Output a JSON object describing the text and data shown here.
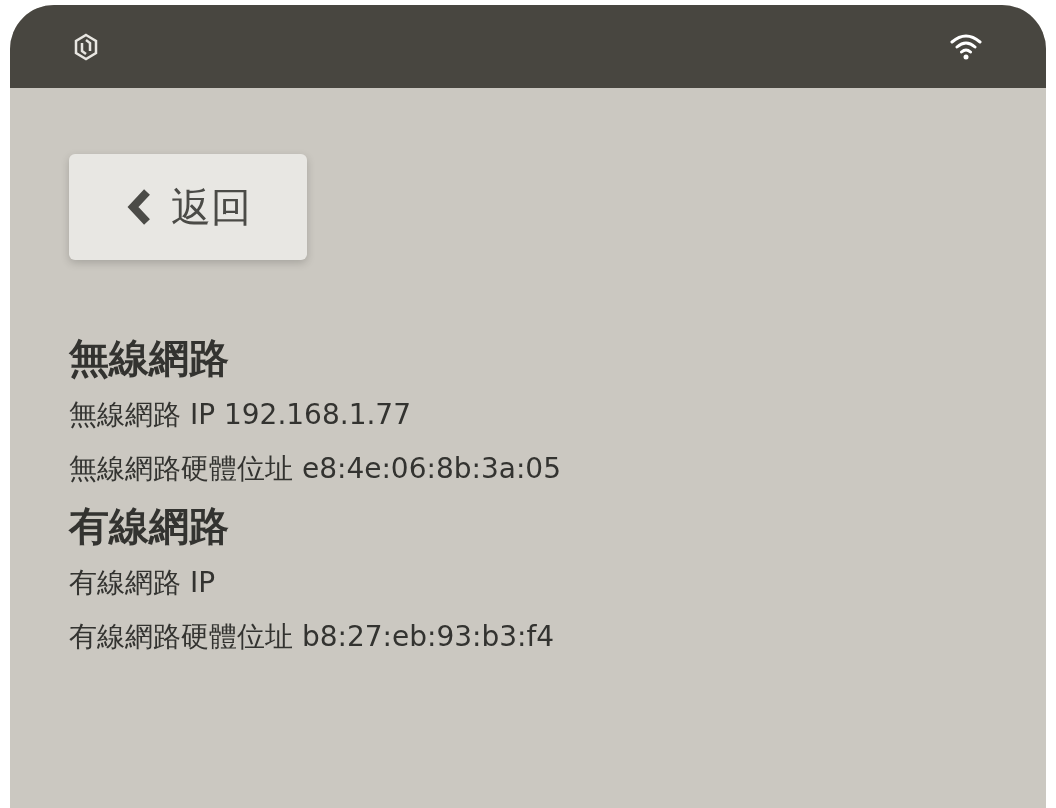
{
  "back_button": {
    "label": "返回"
  },
  "sections": [
    {
      "title": "無線網路",
      "rows": [
        "無線網路 IP 192.168.1.77",
        "無線網路硬體位址 e8:4e:06:8b:3a:05"
      ]
    },
    {
      "title": "有線網路",
      "rows": [
        "有線網路 IP",
        "有線網路硬體位址 b8:27:eb:93:b3:f4"
      ]
    }
  ]
}
